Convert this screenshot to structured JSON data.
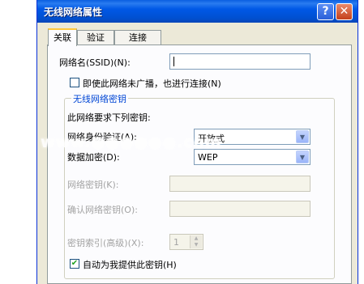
{
  "window": {
    "title": "无线网络属性",
    "help_glyph": "?",
    "close_glyph": "✕"
  },
  "tabs": [
    {
      "label": "关联",
      "active": true
    },
    {
      "label": "验证",
      "active": false
    },
    {
      "label": "连接",
      "active": false
    }
  ],
  "ssid": {
    "label": "网络名(SSID)(N):",
    "value": ""
  },
  "broadcast": {
    "label": "即使此网络未广播，也进行连接(N)",
    "checked": false
  },
  "wireless_key": {
    "group_title": "无线网络密钥",
    "intro": "此网络要求下列密钥:",
    "auth_label": "网络身份验证(A):",
    "auth_value": "开放式",
    "encryption_label": "数据加密(D):",
    "encryption_value": "WEP",
    "network_key_label": "网络密钥(K):",
    "confirm_key_label": "确认网络密钥(O):",
    "key_index_label": "密钥索引(高级)(X):",
    "key_index_value": "1",
    "auto_key_label": "自动为我提供此密钥(H)",
    "auto_key_checked": true,
    "check_glyph": "✔",
    "dropdown_glyph": "▼",
    "spin_up": "▲",
    "spin_down": "▼"
  },
  "watermark": "www.●●●●●●.com"
}
